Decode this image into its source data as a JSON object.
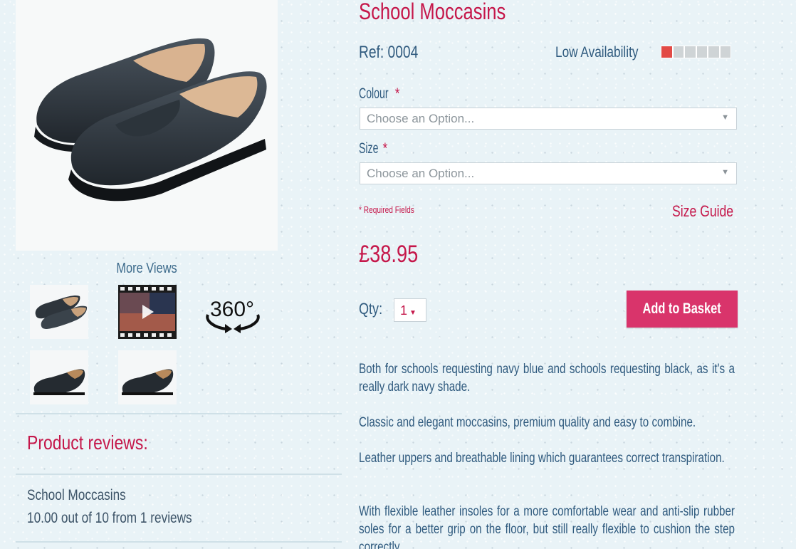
{
  "product": {
    "title": "School Moccasins",
    "ref": "Ref: 0004",
    "availability_label": "Low Availability",
    "availability_level": 0.17,
    "price": "£38.95",
    "description": [
      "Both for schools requesting navy blue and schools requesting black, as it's a really dark navy shade.",
      "Classic and elegant moccasins, premium quality and easy to combine.",
      "Leather uppers and breathable lining which guarantees correct transpiration.",
      "With flexible leather insoles for a more comfortable wear and anti-slip rubber soles for a better grip on the floor, but still really flexible to cushion the step correctly."
    ]
  },
  "options": {
    "colour_label": "Colour",
    "size_label": "Size",
    "required_marker": "*",
    "colour_placeholder": "Choose an Option...",
    "size_placeholder": "Choose an Option...",
    "required_note": "* Required Fields",
    "size_guide": "Size Guide"
  },
  "purchase": {
    "qty_label": "Qty:",
    "qty_value": "1",
    "add_to_basket": "Add to Basket"
  },
  "gallery": {
    "more_views": "More Views",
    "thumbnails": [
      "shoe-pair-thumb",
      "video-thumb",
      "360-view-thumb",
      "shoe-side-thumb",
      "shoe-side-thumb-2"
    ],
    "view_360_label": "360°"
  },
  "reviews": {
    "heading": "Product reviews:",
    "product_name": "School Moccasins",
    "summary": "10.00 out of 10 from 1 reviews"
  },
  "colors": {
    "accent": "#c5174a",
    "button": "#d9346b",
    "text": "#2f5a7e",
    "background": "#e9f3f7"
  }
}
